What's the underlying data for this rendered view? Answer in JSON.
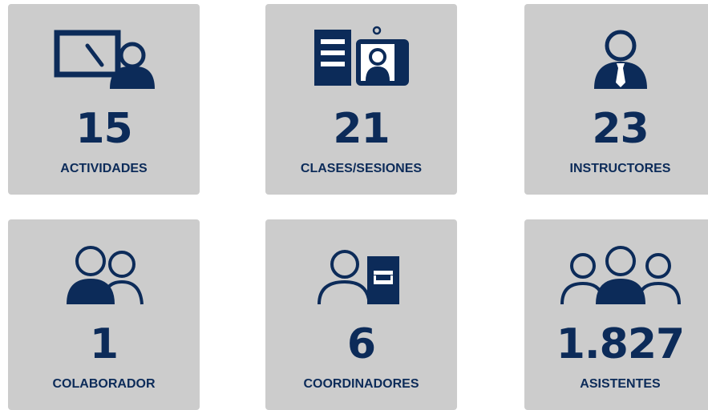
{
  "colors": {
    "card_background": "#cccccc",
    "accent": "#0c2b59",
    "page_background": "#ffffff"
  },
  "stats": [
    {
      "value": "15",
      "label": "ACTIVIDADES",
      "icon": "presentation-icon"
    },
    {
      "value": "21",
      "label": "CLASES/SESIONES",
      "icon": "video-class-icon"
    },
    {
      "value": "23",
      "label": "INSTRUCTORES",
      "icon": "instructor-icon"
    },
    {
      "value": "1",
      "label": "COLABORADOR",
      "icon": "collaborators-icon"
    },
    {
      "value": "6",
      "label": "COORDINADORES",
      "icon": "coordinator-icon"
    },
    {
      "value": "1.827",
      "label": "ASISTENTES",
      "icon": "attendees-icon"
    }
  ]
}
